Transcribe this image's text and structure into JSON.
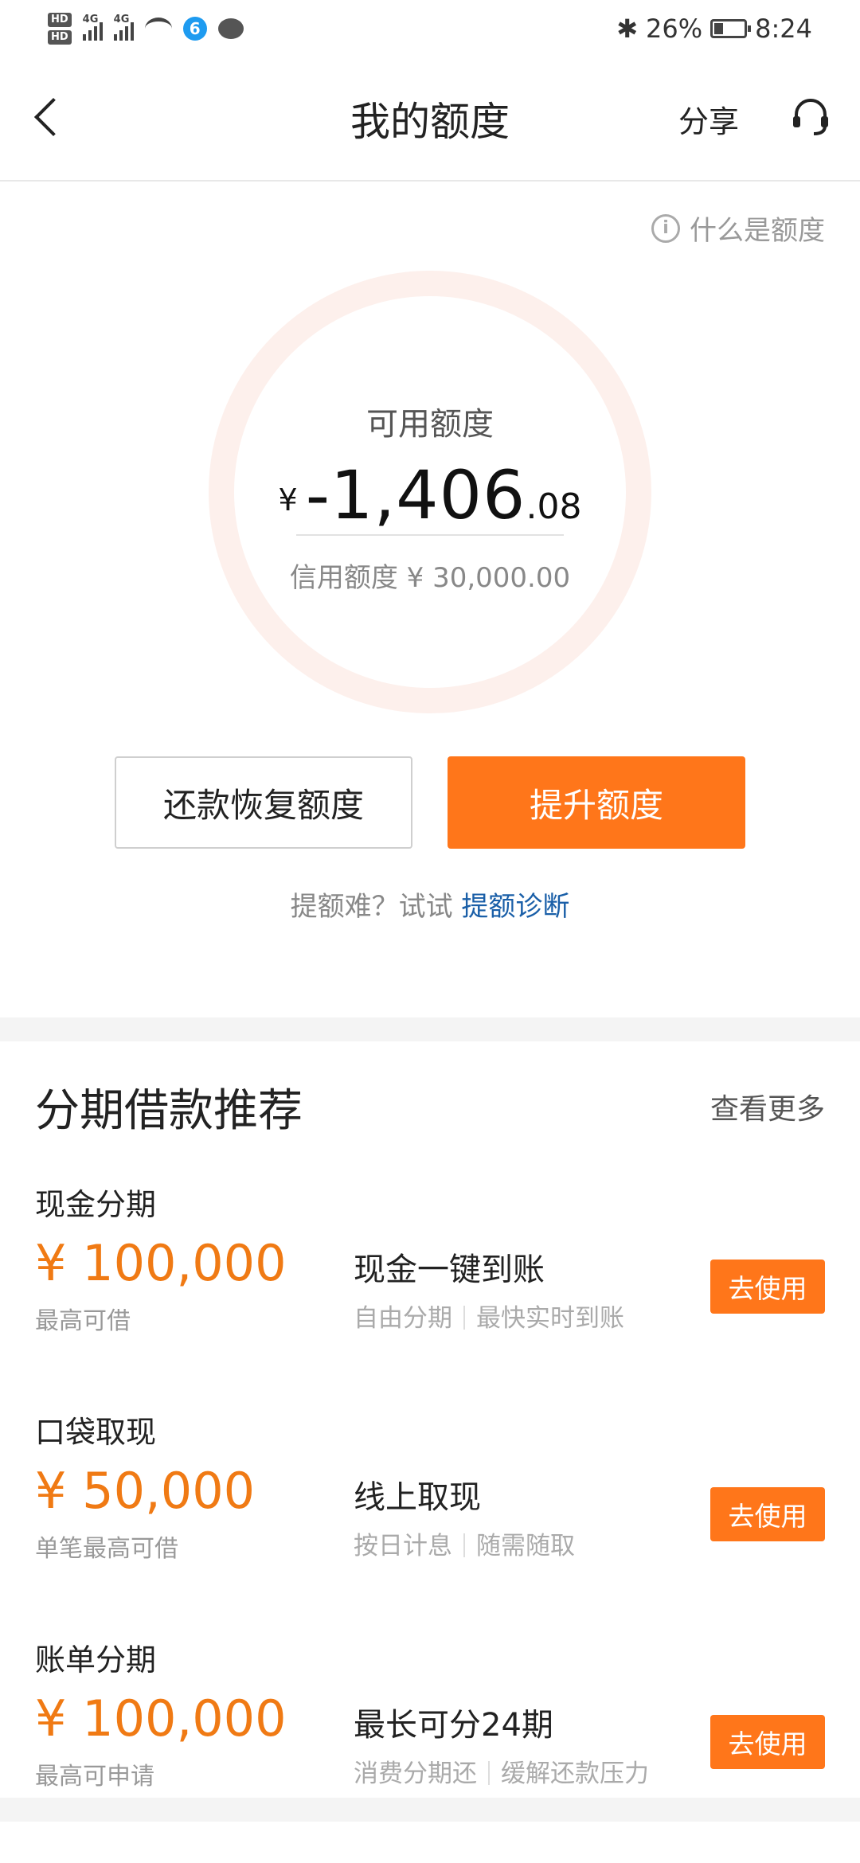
{
  "status_bar": {
    "hd1": "HD",
    "hd2": "HD",
    "net1": "4G",
    "net2": "4G",
    "bluetooth": "✱",
    "battery": "26%",
    "time": "8:24"
  },
  "nav": {
    "title": "我的额度",
    "share": "分享"
  },
  "hero": {
    "what_label": "什么是额度",
    "available_label": "可用额度",
    "currency": "¥",
    "amount_main": "-1,406",
    "amount_decimal": ".08",
    "credit_line": "信用额度 ¥ 30,000.00",
    "repay_button": "还款恢复额度",
    "raise_button": "提升额度",
    "hint_prefix": "提额难？试试 ",
    "hint_link": "提额诊断"
  },
  "recommend": {
    "title": "分期借款推荐",
    "more": "查看更多",
    "items": [
      {
        "name": "现金分期",
        "amount": "¥ 100,000",
        "sub": "最高可借",
        "title": "现金一键到账",
        "tag1": "自由分期",
        "tag2": "最快实时到账",
        "button": "去使用"
      },
      {
        "name": "口袋取现",
        "amount": "¥ 50,000",
        "sub": "单笔最高可借",
        "title": "线上取现",
        "tag1": "按日计息",
        "tag2": "随需随取",
        "button": "去使用"
      },
      {
        "name": "账单分期",
        "amount": "¥ 100,000",
        "sub": "最高可申请",
        "title": "最长可分24期",
        "tag1": "消费分期还",
        "tag2": "缓解还款压力",
        "button": "去使用"
      }
    ]
  },
  "colors": {
    "accent": "#ff761a",
    "link": "#1a5fa8",
    "ring": "#fdf0ec"
  }
}
